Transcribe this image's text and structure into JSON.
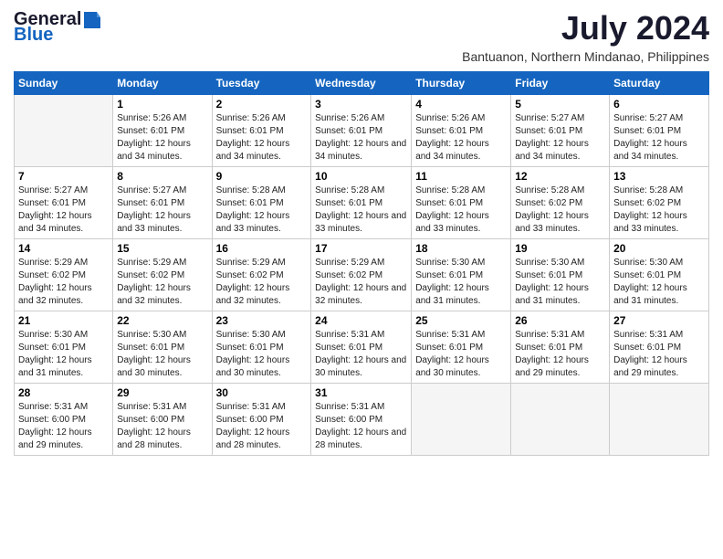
{
  "logo": {
    "general": "General",
    "blue": "Blue"
  },
  "title": {
    "month_year": "July 2024",
    "location": "Bantuanon, Northern Mindanao, Philippines"
  },
  "days_of_week": [
    "Sunday",
    "Monday",
    "Tuesday",
    "Wednesday",
    "Thursday",
    "Friday",
    "Saturday"
  ],
  "weeks": [
    {
      "days": [
        {
          "date": "",
          "sunrise": "",
          "sunset": "",
          "daylight": "",
          "empty": true
        },
        {
          "date": "1",
          "sunrise": "Sunrise: 5:26 AM",
          "sunset": "Sunset: 6:01 PM",
          "daylight": "Daylight: 12 hours and 34 minutes.",
          "empty": false
        },
        {
          "date": "2",
          "sunrise": "Sunrise: 5:26 AM",
          "sunset": "Sunset: 6:01 PM",
          "daylight": "Daylight: 12 hours and 34 minutes.",
          "empty": false
        },
        {
          "date": "3",
          "sunrise": "Sunrise: 5:26 AM",
          "sunset": "Sunset: 6:01 PM",
          "daylight": "Daylight: 12 hours and 34 minutes.",
          "empty": false
        },
        {
          "date": "4",
          "sunrise": "Sunrise: 5:26 AM",
          "sunset": "Sunset: 6:01 PM",
          "daylight": "Daylight: 12 hours and 34 minutes.",
          "empty": false
        },
        {
          "date": "5",
          "sunrise": "Sunrise: 5:27 AM",
          "sunset": "Sunset: 6:01 PM",
          "daylight": "Daylight: 12 hours and 34 minutes.",
          "empty": false
        },
        {
          "date": "6",
          "sunrise": "Sunrise: 5:27 AM",
          "sunset": "Sunset: 6:01 PM",
          "daylight": "Daylight: 12 hours and 34 minutes.",
          "empty": false
        }
      ]
    },
    {
      "days": [
        {
          "date": "7",
          "sunrise": "Sunrise: 5:27 AM",
          "sunset": "Sunset: 6:01 PM",
          "daylight": "Daylight: 12 hours and 34 minutes.",
          "empty": false
        },
        {
          "date": "8",
          "sunrise": "Sunrise: 5:27 AM",
          "sunset": "Sunset: 6:01 PM",
          "daylight": "Daylight: 12 hours and 33 minutes.",
          "empty": false
        },
        {
          "date": "9",
          "sunrise": "Sunrise: 5:28 AM",
          "sunset": "Sunset: 6:01 PM",
          "daylight": "Daylight: 12 hours and 33 minutes.",
          "empty": false
        },
        {
          "date": "10",
          "sunrise": "Sunrise: 5:28 AM",
          "sunset": "Sunset: 6:01 PM",
          "daylight": "Daylight: 12 hours and 33 minutes.",
          "empty": false
        },
        {
          "date": "11",
          "sunrise": "Sunrise: 5:28 AM",
          "sunset": "Sunset: 6:01 PM",
          "daylight": "Daylight: 12 hours and 33 minutes.",
          "empty": false
        },
        {
          "date": "12",
          "sunrise": "Sunrise: 5:28 AM",
          "sunset": "Sunset: 6:02 PM",
          "daylight": "Daylight: 12 hours and 33 minutes.",
          "empty": false
        },
        {
          "date": "13",
          "sunrise": "Sunrise: 5:28 AM",
          "sunset": "Sunset: 6:02 PM",
          "daylight": "Daylight: 12 hours and 33 minutes.",
          "empty": false
        }
      ]
    },
    {
      "days": [
        {
          "date": "14",
          "sunrise": "Sunrise: 5:29 AM",
          "sunset": "Sunset: 6:02 PM",
          "daylight": "Daylight: 12 hours and 32 minutes.",
          "empty": false
        },
        {
          "date": "15",
          "sunrise": "Sunrise: 5:29 AM",
          "sunset": "Sunset: 6:02 PM",
          "daylight": "Daylight: 12 hours and 32 minutes.",
          "empty": false
        },
        {
          "date": "16",
          "sunrise": "Sunrise: 5:29 AM",
          "sunset": "Sunset: 6:02 PM",
          "daylight": "Daylight: 12 hours and 32 minutes.",
          "empty": false
        },
        {
          "date": "17",
          "sunrise": "Sunrise: 5:29 AM",
          "sunset": "Sunset: 6:02 PM",
          "daylight": "Daylight: 12 hours and 32 minutes.",
          "empty": false
        },
        {
          "date": "18",
          "sunrise": "Sunrise: 5:30 AM",
          "sunset": "Sunset: 6:01 PM",
          "daylight": "Daylight: 12 hours and 31 minutes.",
          "empty": false
        },
        {
          "date": "19",
          "sunrise": "Sunrise: 5:30 AM",
          "sunset": "Sunset: 6:01 PM",
          "daylight": "Daylight: 12 hours and 31 minutes.",
          "empty": false
        },
        {
          "date": "20",
          "sunrise": "Sunrise: 5:30 AM",
          "sunset": "Sunset: 6:01 PM",
          "daylight": "Daylight: 12 hours and 31 minutes.",
          "empty": false
        }
      ]
    },
    {
      "days": [
        {
          "date": "21",
          "sunrise": "Sunrise: 5:30 AM",
          "sunset": "Sunset: 6:01 PM",
          "daylight": "Daylight: 12 hours and 31 minutes.",
          "empty": false
        },
        {
          "date": "22",
          "sunrise": "Sunrise: 5:30 AM",
          "sunset": "Sunset: 6:01 PM",
          "daylight": "Daylight: 12 hours and 30 minutes.",
          "empty": false
        },
        {
          "date": "23",
          "sunrise": "Sunrise: 5:30 AM",
          "sunset": "Sunset: 6:01 PM",
          "daylight": "Daylight: 12 hours and 30 minutes.",
          "empty": false
        },
        {
          "date": "24",
          "sunrise": "Sunrise: 5:31 AM",
          "sunset": "Sunset: 6:01 PM",
          "daylight": "Daylight: 12 hours and 30 minutes.",
          "empty": false
        },
        {
          "date": "25",
          "sunrise": "Sunrise: 5:31 AM",
          "sunset": "Sunset: 6:01 PM",
          "daylight": "Daylight: 12 hours and 30 minutes.",
          "empty": false
        },
        {
          "date": "26",
          "sunrise": "Sunrise: 5:31 AM",
          "sunset": "Sunset: 6:01 PM",
          "daylight": "Daylight: 12 hours and 29 minutes.",
          "empty": false
        },
        {
          "date": "27",
          "sunrise": "Sunrise: 5:31 AM",
          "sunset": "Sunset: 6:01 PM",
          "daylight": "Daylight: 12 hours and 29 minutes.",
          "empty": false
        }
      ]
    },
    {
      "days": [
        {
          "date": "28",
          "sunrise": "Sunrise: 5:31 AM",
          "sunset": "Sunset: 6:00 PM",
          "daylight": "Daylight: 12 hours and 29 minutes.",
          "empty": false
        },
        {
          "date": "29",
          "sunrise": "Sunrise: 5:31 AM",
          "sunset": "Sunset: 6:00 PM",
          "daylight": "Daylight: 12 hours and 28 minutes.",
          "empty": false
        },
        {
          "date": "30",
          "sunrise": "Sunrise: 5:31 AM",
          "sunset": "Sunset: 6:00 PM",
          "daylight": "Daylight: 12 hours and 28 minutes.",
          "empty": false
        },
        {
          "date": "31",
          "sunrise": "Sunrise: 5:31 AM",
          "sunset": "Sunset: 6:00 PM",
          "daylight": "Daylight: 12 hours and 28 minutes.",
          "empty": false
        },
        {
          "date": "",
          "sunrise": "",
          "sunset": "",
          "daylight": "",
          "empty": true
        },
        {
          "date": "",
          "sunrise": "",
          "sunset": "",
          "daylight": "",
          "empty": true
        },
        {
          "date": "",
          "sunrise": "",
          "sunset": "",
          "daylight": "",
          "empty": true
        }
      ]
    }
  ]
}
